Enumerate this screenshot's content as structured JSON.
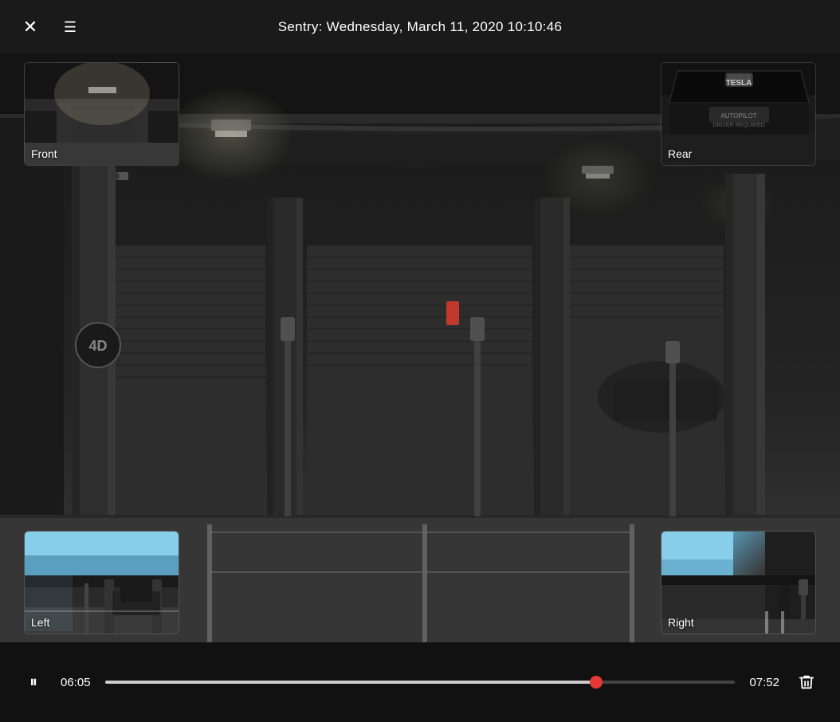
{
  "header": {
    "title": "Sentry: Wednesday, March 11, 2020 10:10:46",
    "close_label": "✕",
    "menu_label": "☰"
  },
  "thumbnails": {
    "front": {
      "label": "Front"
    },
    "rear": {
      "label": "Rear"
    },
    "left": {
      "label": "Left"
    },
    "right": {
      "label": "Right"
    }
  },
  "controls": {
    "play_pause_icon": "⏸",
    "time_current": "06:05",
    "time_total": "07:52",
    "delete_icon": "🗑",
    "progress_percent": 78
  }
}
